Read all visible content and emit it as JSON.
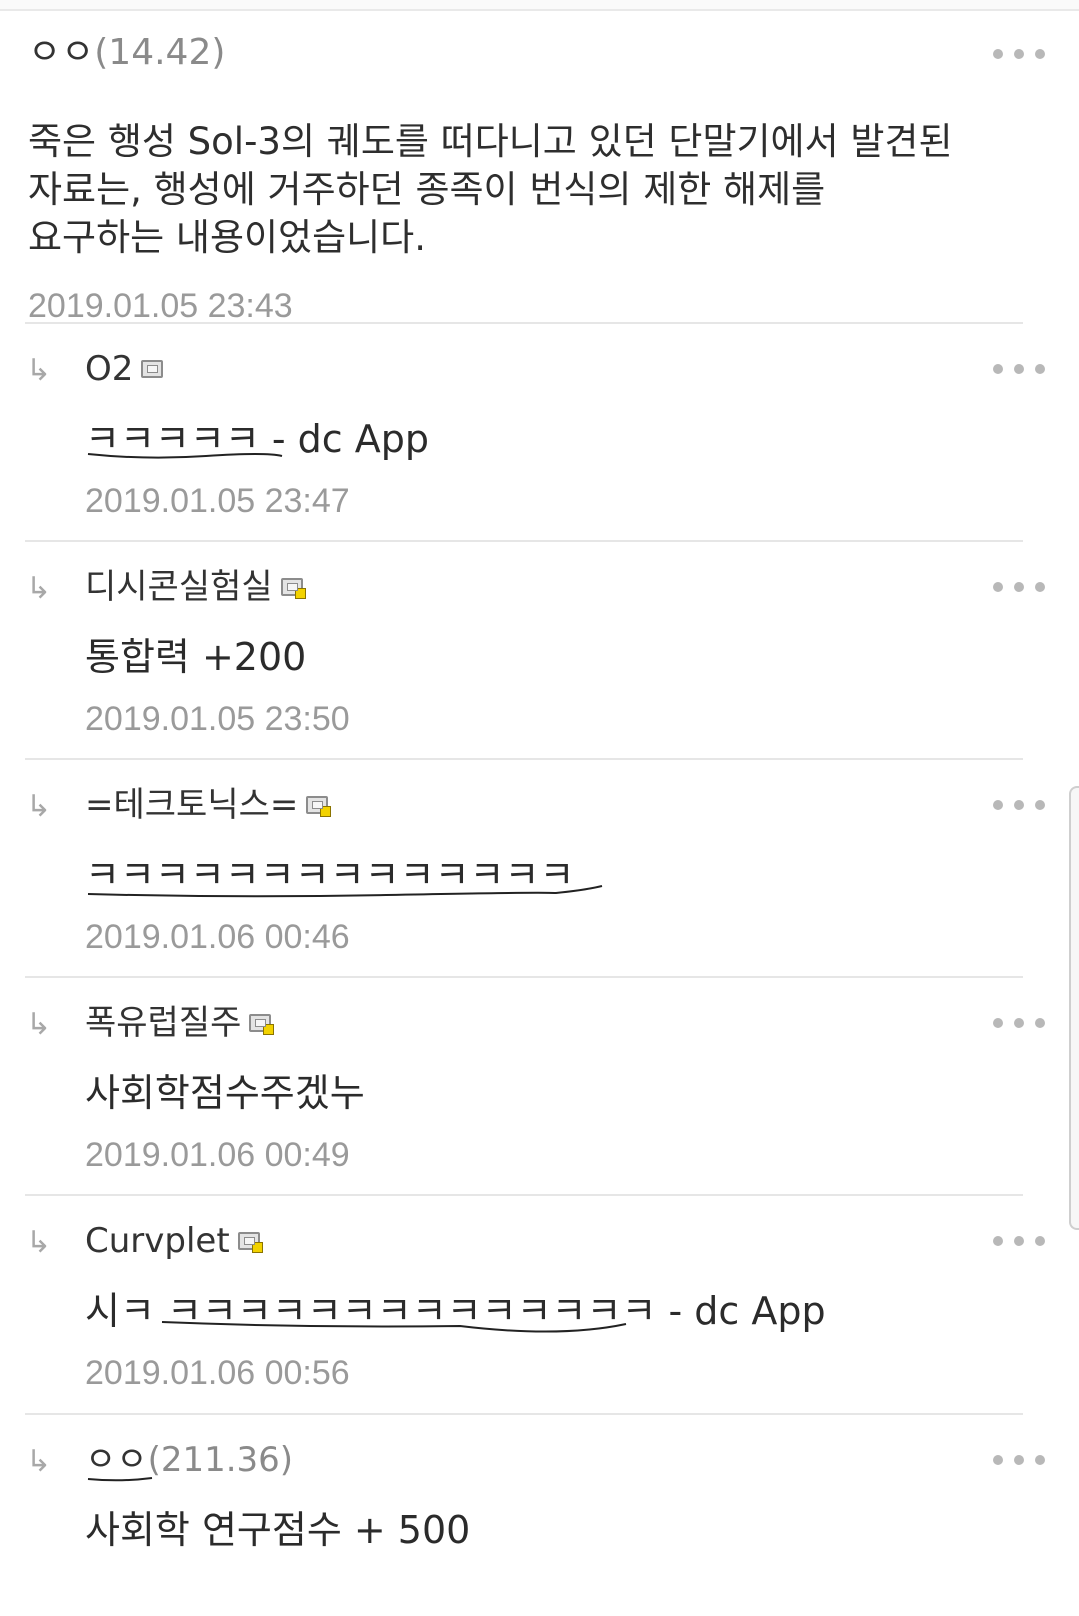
{
  "main_comment": {
    "author": "ㅇㅇ",
    "ip": "(14.42)",
    "text_lines": [
      "죽은 행성 Sol-3의 궤도를 떠다니고 있던 단말기에서 발견된",
      "자료는, 행성에 거주하던 종족이 번식의 제한 해제를",
      "요구하는 내용이었습니다."
    ],
    "timestamp": "2019.01.05 23:43",
    "more_icon": "more-horizontal-icon"
  },
  "replies": [
    {
      "arrow": "↳",
      "author": "O2",
      "ip": "",
      "icon": "gallog-icon",
      "text": "ㅋㅋㅋㅋㅋ - dc App",
      "timestamp": "2019.01.05 23:47"
    },
    {
      "arrow": "↳",
      "author": "디시콘실험실",
      "ip": "",
      "icon": "gallog-fixed-icon",
      "text": "통합력 +200",
      "timestamp": "2019.01.05 23:50"
    },
    {
      "arrow": "↳",
      "author": "=테크토닉스=",
      "ip": "",
      "icon": "gallog-fixed-icon",
      "text": "ㅋㅋㅋㅋㅋㅋㅋㅋㅋㅋㅋㅋㅋㅋ",
      "timestamp": "2019.01.06 00:46"
    },
    {
      "arrow": "↳",
      "author": "폭유럽질주",
      "ip": "",
      "icon": "gallog-fixed-icon",
      "text": "사회학점수주겠누",
      "timestamp": "2019.01.06 00:49"
    },
    {
      "arrow": "↳",
      "author": "Curvplet",
      "ip": "",
      "icon": "gallog-fixed-icon",
      "text": "시ㅋ ㅋㅋㅋㅋㅋㅋㅋㅋㅋㅋㅋㅋㅋㅋ - dc App",
      "timestamp": "2019.01.06 00:56"
    },
    {
      "arrow": "↳",
      "author": "ㅇㅇ",
      "ip": "(211.36)",
      "icon": "",
      "text": "사회학 연구점수 + 500",
      "timestamp": ""
    }
  ],
  "colors": {
    "text": "#2b2b2b",
    "meta": "#9a9a9a",
    "divider": "#e6e6e6",
    "dots": "#b8b8b8",
    "badge": "#f2d200"
  }
}
